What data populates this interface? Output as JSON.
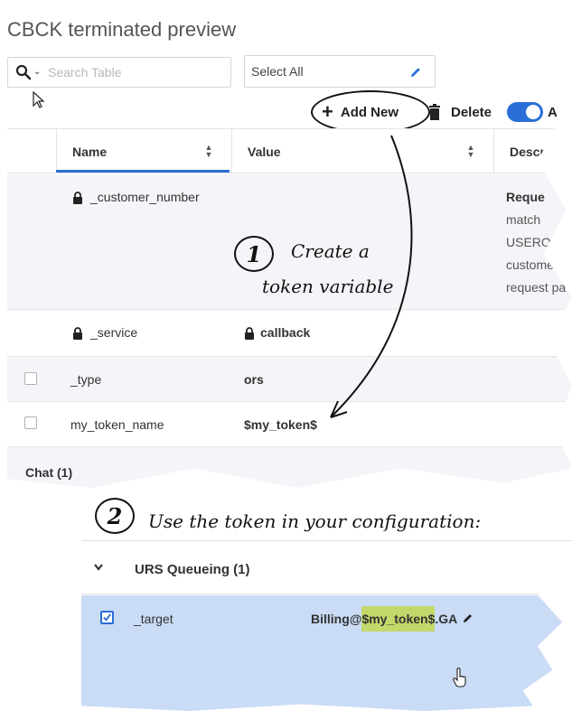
{
  "app": {
    "title": "CBCK terminated preview"
  },
  "search": {
    "placeholder": "Search Table",
    "caret": "⌄"
  },
  "select": {
    "value": "Select All"
  },
  "toolbar": {
    "add_label": "Add New",
    "delete_label": "Delete",
    "toggle_label": "A",
    "toggle_on": true
  },
  "table": {
    "columns": [
      "Name",
      "Value",
      "Descr"
    ],
    "rows": [
      {
        "name": "_customer_number",
        "value": "",
        "locked": true,
        "desc": [
          "Reque",
          "match",
          "USEROF",
          "custome",
          "request pa"
        ]
      },
      {
        "name": "_service",
        "value": "callback",
        "locked": true
      },
      {
        "name": "_type",
        "value": "ors",
        "locked": false
      },
      {
        "name": "my_token_name",
        "value": "$my_token$",
        "locked": false
      }
    ],
    "group_partial": "Chat (1)"
  },
  "annotations": {
    "step1_number": "1",
    "step1_line1": "Create a",
    "step1_line2": "token variable",
    "step2_number": "2",
    "step2_text": "Use the token in your configuration:"
  },
  "config_panel": {
    "group_title": "URS Queueing (1)",
    "row_name": "_target",
    "value_prefix": "Billing@",
    "value_token": "$my_token$",
    "value_suffix": ".GA",
    "checked": true
  },
  "colors": {
    "accent": "#2b6ed8",
    "highlight": "#c3d86a",
    "selected_row": "#c9dbf5"
  },
  "icons": [
    "search-icon",
    "pencil-icon",
    "plus-icon",
    "trash-icon",
    "lock-icon",
    "chevron-down-icon",
    "hand-cursor-icon",
    "arrow-cursor-icon"
  ]
}
